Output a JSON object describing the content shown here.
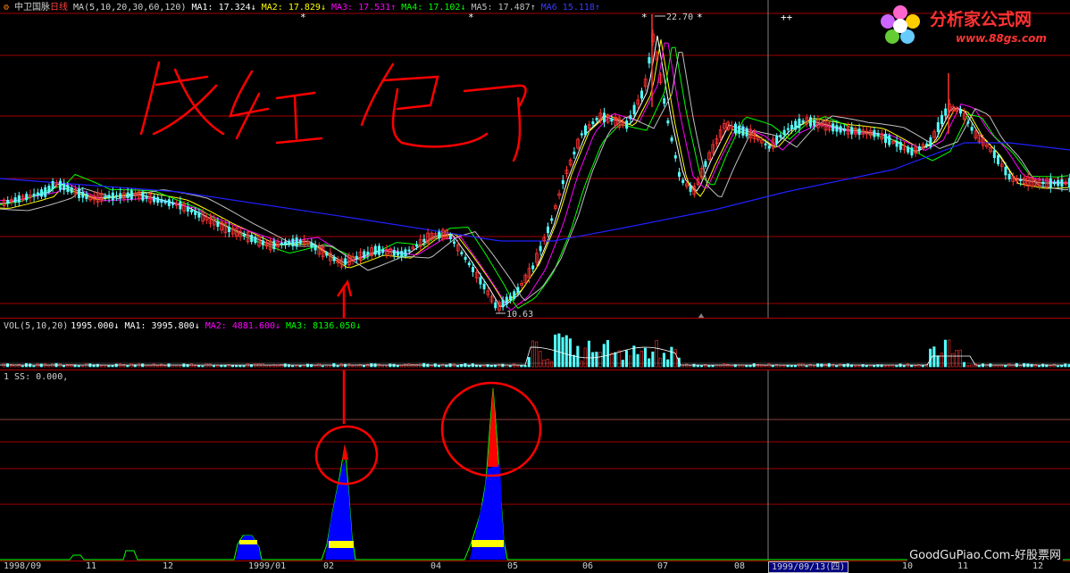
{
  "main": {
    "app_icon": "gear-icon",
    "stock_name": "中卫国脉",
    "period": "日线",
    "ma_params": "MA(5,10,20,30,60,120)",
    "ma1": "MA1: 17.324↓",
    "ma2": "MA2: 17.829↓",
    "ma3": "MA3: 17.531↑",
    "ma4": "MA4: 17.102↓",
    "ma5": "MA5: 17.487↑",
    "ma6": "MA6  15.118↑",
    "high_label": "22.70",
    "low_label": "10.63",
    "markers": [
      "*",
      "*",
      "*",
      "*",
      "++"
    ]
  },
  "volume": {
    "params": "VOL(5,10,20)",
    "vol": "1995.000↓",
    "ma1": "MA1: 3995.800↓",
    "ma2": "MA2: 4881.600↓",
    "ma3": "MA3: 8136.050↓"
  },
  "indicator": {
    "label": "1 SS: 0.000,"
  },
  "handwriting": "发红包了",
  "xaxis": {
    "labels": [
      "1998/09",
      "11",
      "12",
      "1999/01",
      "02",
      "04",
      "05",
      "06",
      "07",
      "08",
      "10",
      "11",
      "12"
    ],
    "date_box": "1999/09/13(四)"
  },
  "logo": {
    "name": "分析家公式网",
    "url": "www.88gs.com"
  },
  "watermark": "GoodGuPiao.Com-好股票网",
  "colors": {
    "up": "#ff3232",
    "down": "#54ffff",
    "ma1": "#ffffff",
    "ma2": "#ffff00",
    "ma3": "#ff00ff",
    "ma4": "#00ff00",
    "ma5": "#c0c0c0",
    "ma6": "#0000ff",
    "grid": "#a00000",
    "handwriting": "#ff0000"
  }
}
